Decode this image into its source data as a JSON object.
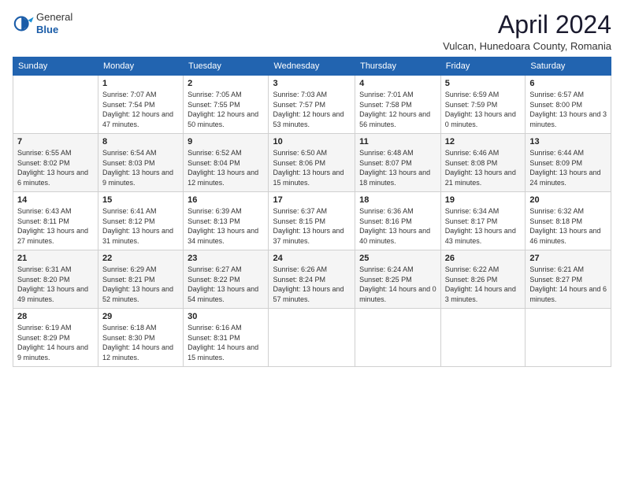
{
  "logo": {
    "general": "General",
    "blue": "Blue"
  },
  "title": "April 2024",
  "subtitle": "Vulcan, Hunedoara County, Romania",
  "days_header": [
    "Sunday",
    "Monday",
    "Tuesday",
    "Wednesday",
    "Thursday",
    "Friday",
    "Saturday"
  ],
  "weeks": [
    [
      {
        "num": "",
        "sunrise": "",
        "sunset": "",
        "daylight": ""
      },
      {
        "num": "1",
        "sunrise": "Sunrise: 7:07 AM",
        "sunset": "Sunset: 7:54 PM",
        "daylight": "Daylight: 12 hours and 47 minutes."
      },
      {
        "num": "2",
        "sunrise": "Sunrise: 7:05 AM",
        "sunset": "Sunset: 7:55 PM",
        "daylight": "Daylight: 12 hours and 50 minutes."
      },
      {
        "num": "3",
        "sunrise": "Sunrise: 7:03 AM",
        "sunset": "Sunset: 7:57 PM",
        "daylight": "Daylight: 12 hours and 53 minutes."
      },
      {
        "num": "4",
        "sunrise": "Sunrise: 7:01 AM",
        "sunset": "Sunset: 7:58 PM",
        "daylight": "Daylight: 12 hours and 56 minutes."
      },
      {
        "num": "5",
        "sunrise": "Sunrise: 6:59 AM",
        "sunset": "Sunset: 7:59 PM",
        "daylight": "Daylight: 13 hours and 0 minutes."
      },
      {
        "num": "6",
        "sunrise": "Sunrise: 6:57 AM",
        "sunset": "Sunset: 8:00 PM",
        "daylight": "Daylight: 13 hours and 3 minutes."
      }
    ],
    [
      {
        "num": "7",
        "sunrise": "Sunrise: 6:55 AM",
        "sunset": "Sunset: 8:02 PM",
        "daylight": "Daylight: 13 hours and 6 minutes."
      },
      {
        "num": "8",
        "sunrise": "Sunrise: 6:54 AM",
        "sunset": "Sunset: 8:03 PM",
        "daylight": "Daylight: 13 hours and 9 minutes."
      },
      {
        "num": "9",
        "sunrise": "Sunrise: 6:52 AM",
        "sunset": "Sunset: 8:04 PM",
        "daylight": "Daylight: 13 hours and 12 minutes."
      },
      {
        "num": "10",
        "sunrise": "Sunrise: 6:50 AM",
        "sunset": "Sunset: 8:06 PM",
        "daylight": "Daylight: 13 hours and 15 minutes."
      },
      {
        "num": "11",
        "sunrise": "Sunrise: 6:48 AM",
        "sunset": "Sunset: 8:07 PM",
        "daylight": "Daylight: 13 hours and 18 minutes."
      },
      {
        "num": "12",
        "sunrise": "Sunrise: 6:46 AM",
        "sunset": "Sunset: 8:08 PM",
        "daylight": "Daylight: 13 hours and 21 minutes."
      },
      {
        "num": "13",
        "sunrise": "Sunrise: 6:44 AM",
        "sunset": "Sunset: 8:09 PM",
        "daylight": "Daylight: 13 hours and 24 minutes."
      }
    ],
    [
      {
        "num": "14",
        "sunrise": "Sunrise: 6:43 AM",
        "sunset": "Sunset: 8:11 PM",
        "daylight": "Daylight: 13 hours and 27 minutes."
      },
      {
        "num": "15",
        "sunrise": "Sunrise: 6:41 AM",
        "sunset": "Sunset: 8:12 PM",
        "daylight": "Daylight: 13 hours and 31 minutes."
      },
      {
        "num": "16",
        "sunrise": "Sunrise: 6:39 AM",
        "sunset": "Sunset: 8:13 PM",
        "daylight": "Daylight: 13 hours and 34 minutes."
      },
      {
        "num": "17",
        "sunrise": "Sunrise: 6:37 AM",
        "sunset": "Sunset: 8:15 PM",
        "daylight": "Daylight: 13 hours and 37 minutes."
      },
      {
        "num": "18",
        "sunrise": "Sunrise: 6:36 AM",
        "sunset": "Sunset: 8:16 PM",
        "daylight": "Daylight: 13 hours and 40 minutes."
      },
      {
        "num": "19",
        "sunrise": "Sunrise: 6:34 AM",
        "sunset": "Sunset: 8:17 PM",
        "daylight": "Daylight: 13 hours and 43 minutes."
      },
      {
        "num": "20",
        "sunrise": "Sunrise: 6:32 AM",
        "sunset": "Sunset: 8:18 PM",
        "daylight": "Daylight: 13 hours and 46 minutes."
      }
    ],
    [
      {
        "num": "21",
        "sunrise": "Sunrise: 6:31 AM",
        "sunset": "Sunset: 8:20 PM",
        "daylight": "Daylight: 13 hours and 49 minutes."
      },
      {
        "num": "22",
        "sunrise": "Sunrise: 6:29 AM",
        "sunset": "Sunset: 8:21 PM",
        "daylight": "Daylight: 13 hours and 52 minutes."
      },
      {
        "num": "23",
        "sunrise": "Sunrise: 6:27 AM",
        "sunset": "Sunset: 8:22 PM",
        "daylight": "Daylight: 13 hours and 54 minutes."
      },
      {
        "num": "24",
        "sunrise": "Sunrise: 6:26 AM",
        "sunset": "Sunset: 8:24 PM",
        "daylight": "Daylight: 13 hours and 57 minutes."
      },
      {
        "num": "25",
        "sunrise": "Sunrise: 6:24 AM",
        "sunset": "Sunset: 8:25 PM",
        "daylight": "Daylight: 14 hours and 0 minutes."
      },
      {
        "num": "26",
        "sunrise": "Sunrise: 6:22 AM",
        "sunset": "Sunset: 8:26 PM",
        "daylight": "Daylight: 14 hours and 3 minutes."
      },
      {
        "num": "27",
        "sunrise": "Sunrise: 6:21 AM",
        "sunset": "Sunset: 8:27 PM",
        "daylight": "Daylight: 14 hours and 6 minutes."
      }
    ],
    [
      {
        "num": "28",
        "sunrise": "Sunrise: 6:19 AM",
        "sunset": "Sunset: 8:29 PM",
        "daylight": "Daylight: 14 hours and 9 minutes."
      },
      {
        "num": "29",
        "sunrise": "Sunrise: 6:18 AM",
        "sunset": "Sunset: 8:30 PM",
        "daylight": "Daylight: 14 hours and 12 minutes."
      },
      {
        "num": "30",
        "sunrise": "Sunrise: 6:16 AM",
        "sunset": "Sunset: 8:31 PM",
        "daylight": "Daylight: 14 hours and 15 minutes."
      },
      {
        "num": "",
        "sunrise": "",
        "sunset": "",
        "daylight": ""
      },
      {
        "num": "",
        "sunrise": "",
        "sunset": "",
        "daylight": ""
      },
      {
        "num": "",
        "sunrise": "",
        "sunset": "",
        "daylight": ""
      },
      {
        "num": "",
        "sunrise": "",
        "sunset": "",
        "daylight": ""
      }
    ]
  ]
}
